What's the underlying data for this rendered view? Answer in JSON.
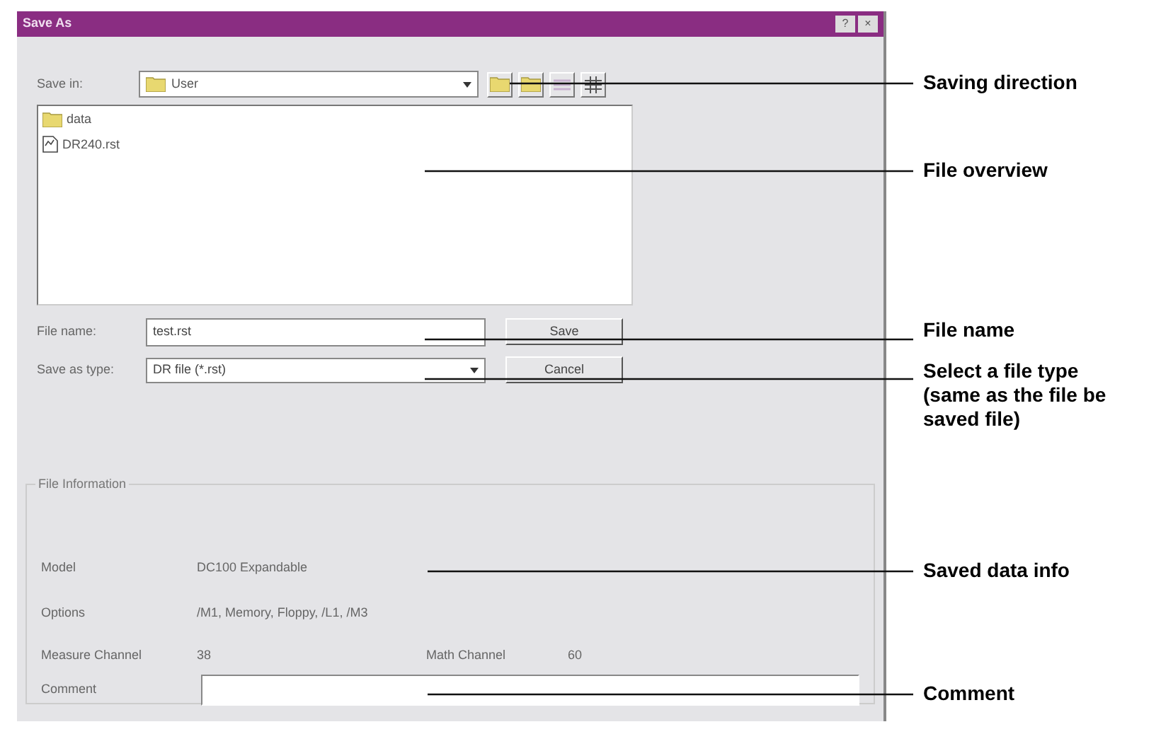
{
  "window": {
    "title": "Save As",
    "title_buttons": [
      "?",
      "×"
    ]
  },
  "save_in": {
    "label": "Save in:",
    "value": "User"
  },
  "files": [
    {
      "name": "data",
      "kind": "folder"
    },
    {
      "name": "DR240.rst",
      "kind": "file"
    }
  ],
  "file_name": {
    "label": "File name:",
    "value": "test.rst"
  },
  "save_as_type": {
    "label": "Save as type:",
    "value": "DR file (*.rst)"
  },
  "buttons": [
    "Save",
    "Cancel"
  ],
  "file_information": {
    "title": "File Information",
    "model_label": "Model",
    "model": "DC100 Expandable",
    "options_label": "Options",
    "options": "/M1, Memory, Floppy, /L1, /M3",
    "measure_label": "Measure Channel",
    "measure": "38",
    "math_label": "Math Channel",
    "math": "60",
    "comment_label": "Comment"
  },
  "annotations": [
    {
      "text": "Saving direction"
    },
    {
      "text": "File overview"
    },
    {
      "text": "File name"
    },
    {
      "text": "Select a file type (same as the file be saved file)"
    },
    {
      "text": "Saved data info"
    },
    {
      "text": "Comment"
    }
  ]
}
